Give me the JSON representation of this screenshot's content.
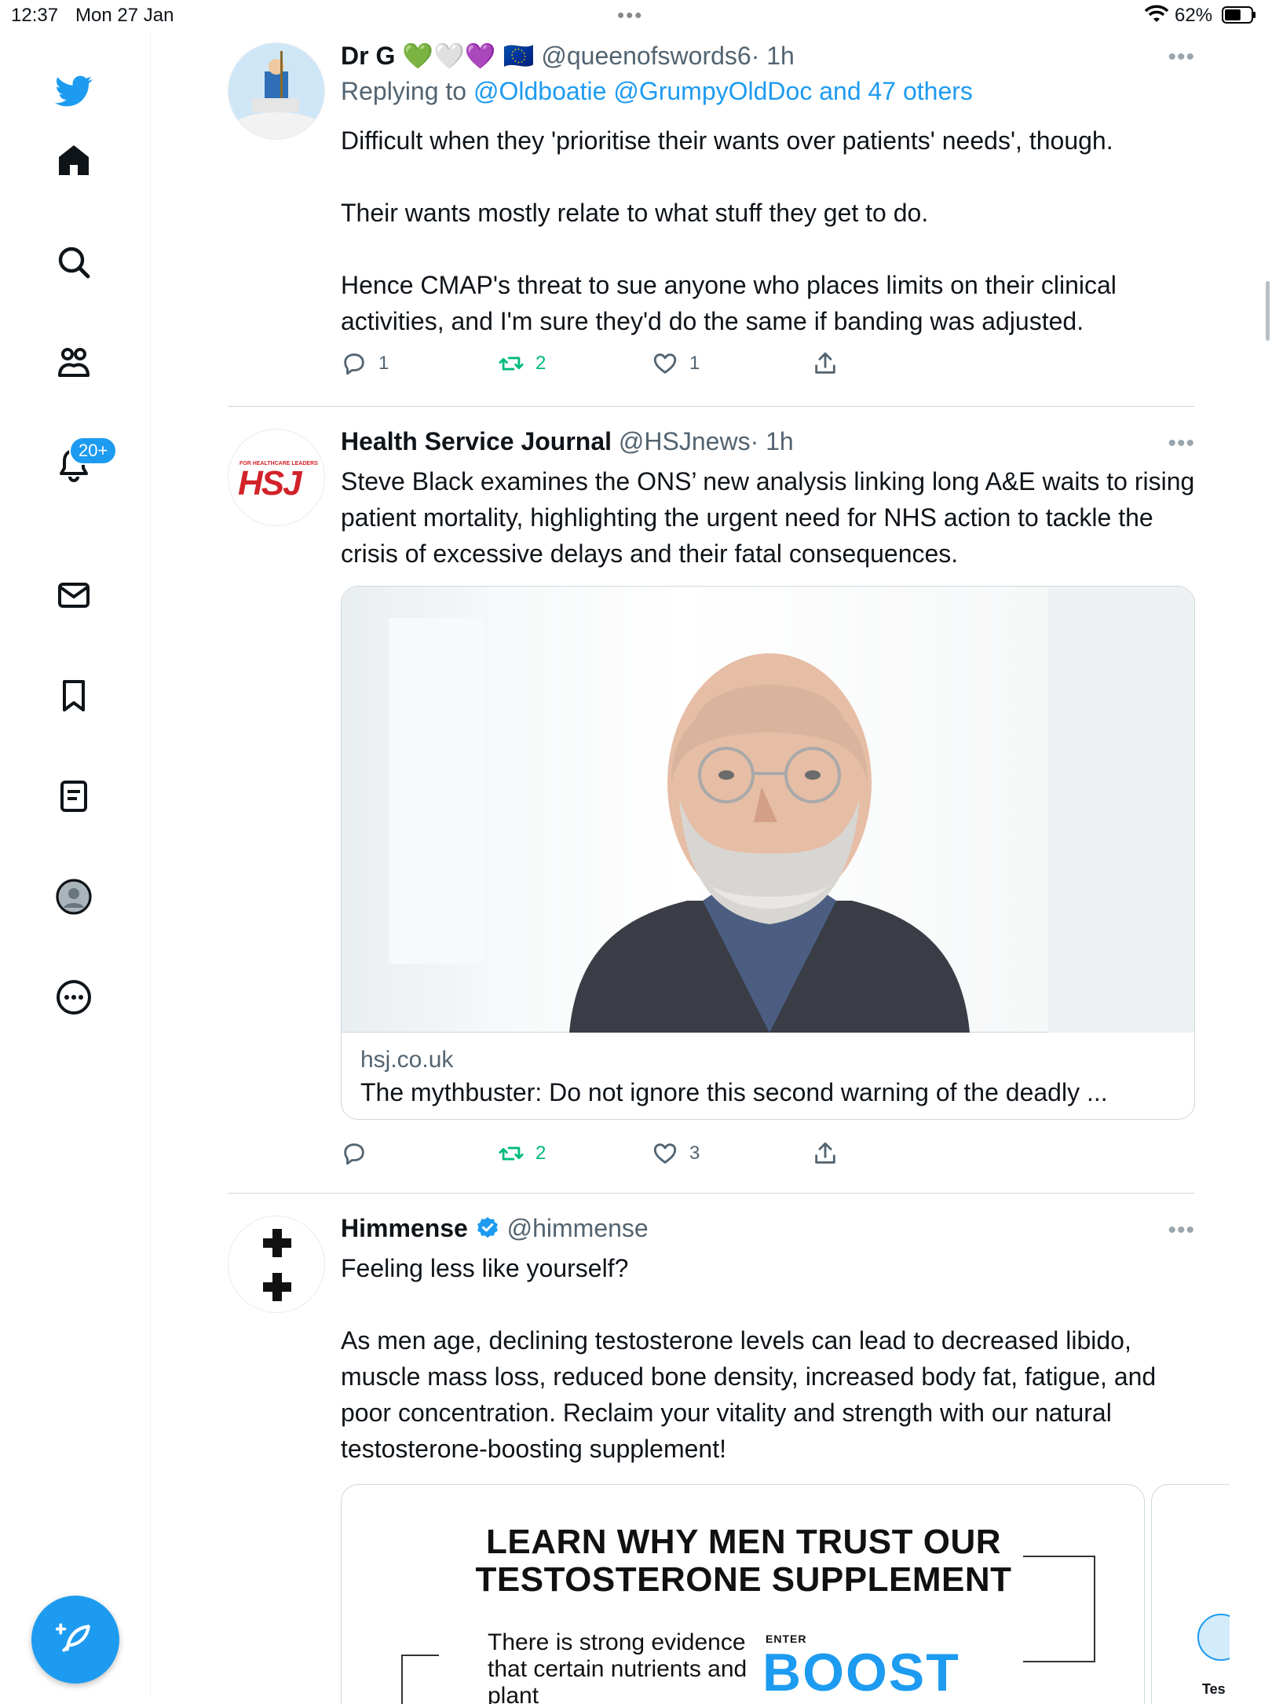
{
  "status": {
    "time": "12:37",
    "date": "Mon 27 Jan",
    "dots": "•••",
    "battery_pct": "62%",
    "battery_level": 0.62
  },
  "sidebar": {
    "items": [
      "twitter-logo",
      "home-icon",
      "search-icon",
      "communities-icon",
      "notifications-icon",
      "messages-icon",
      "bookmarks-icon",
      "lists-icon",
      "profile-icon",
      "more-icon"
    ],
    "notifications_badge": "20+",
    "compose": "compose-tweet-icon"
  },
  "tweets": [
    {
      "name": "Dr G",
      "emojis": "💚🤍💜",
      "flag": "🇪🇺",
      "handle": "@queenofswords6",
      "time": "· 1h",
      "more": "•••",
      "replying_to_label": "Replying to",
      "replying_to_users": "@Oldboatie @GrumpyOldDoc and 47 others",
      "body": [
        "Difficult when they 'prioritise their wants over patients' needs', though.",
        "Their wants mostly relate to what stuff they get to do.",
        "Hence CMAP's threat to sue anyone who places limits on their clinical activities, and I'm sure they'd do the same if banding was adjusted."
      ],
      "replies": "1",
      "retweets": "2",
      "likes": "1"
    },
    {
      "name": "Health Service Journal",
      "handle": "@HSJnews",
      "time": "· 1h",
      "more": "•••",
      "avatar_text": "HSJ",
      "avatar_small": "FOR HEALTHCARE LEADERS",
      "body": [
        "Steve Black examines the ONS’ new analysis linking long A&E waits to rising patient mortality, highlighting the urgent need for NHS action to tackle the crisis of excessive delays and their fatal consequences."
      ],
      "card_domain": "hsj.co.uk",
      "card_title": "The mythbuster: Do not ignore this second warning of the deadly ...",
      "replies": "",
      "retweets": "2",
      "likes": "3"
    },
    {
      "name": "Himmense",
      "handle": "@himmense",
      "more": "•••",
      "body": [
        "Feeling less like yourself?",
        "As men age, declining testosterone levels can lead to decreased libido, muscle mass loss, reduced bone density, increased body fat, fatigue, and poor concentration. Reclaim your vitality and strength with our natural testosterone-boosting supplement!"
      ],
      "ad_heading_1": "LEARN WHY MEN TRUST OUR",
      "ad_heading_2": "TESTOSTERONE SUPPLEMENT",
      "ad_text": "There is strong evidence that certain nutrients and plant",
      "ad_enter": "ENTER",
      "ad_boost": "BOOST",
      "ad2_text": "Tes"
    }
  ],
  "colors": {
    "accent": "#1d9bf0",
    "retweet": "#00ba7c",
    "secondary": "#536471",
    "hsj_red": "#d2232a"
  }
}
